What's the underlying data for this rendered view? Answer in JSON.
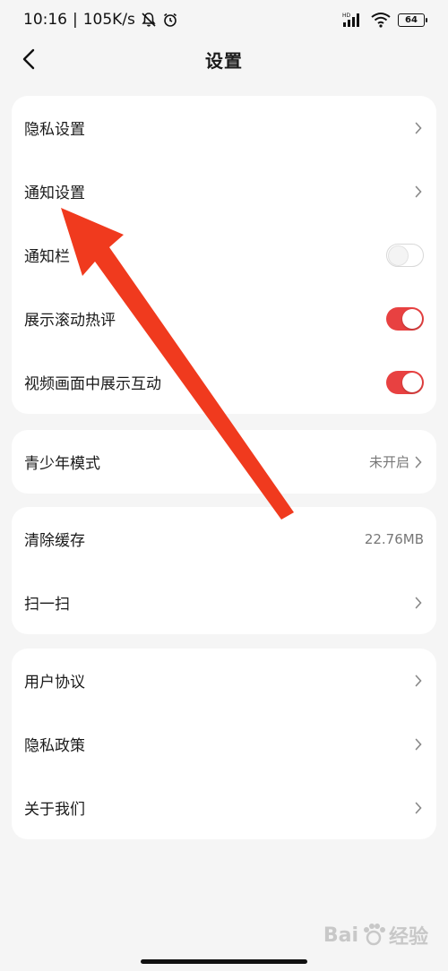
{
  "status_bar": {
    "time": "10:16",
    "speed": "105K/s",
    "battery": "64",
    "hd_label": "HD"
  },
  "nav": {
    "title": "设置"
  },
  "group1": {
    "items": [
      {
        "label": "隐私设置",
        "type": "link"
      },
      {
        "label": "通知设置",
        "type": "link"
      },
      {
        "label": "通知栏",
        "type": "toggle",
        "on": false
      },
      {
        "label": "展示滚动热评",
        "type": "toggle",
        "on": true
      },
      {
        "label": "视频画面中展示互动",
        "type": "toggle",
        "on": true
      }
    ]
  },
  "group2": {
    "items": [
      {
        "label": "青少年模式",
        "value": "未开启",
        "type": "link"
      }
    ]
  },
  "group3": {
    "items": [
      {
        "label": "清除缓存",
        "value": "22.76MB",
        "type": "value"
      },
      {
        "label": "扫一扫",
        "type": "link"
      }
    ]
  },
  "group4": {
    "items": [
      {
        "label": "用户协议",
        "type": "link"
      },
      {
        "label": "隐私政策",
        "type": "link"
      },
      {
        "label": "关于我们",
        "type": "link"
      }
    ]
  },
  "watermark": {
    "brand_text": "Bai",
    "brand_suffix": "经验"
  },
  "colors": {
    "accent": "#e84141",
    "arrow": "#f03a1e",
    "background": "#f5f5f5",
    "card": "#ffffff"
  },
  "icons": {
    "back": "chevron-left-icon",
    "row_arrow": "chevron-right-icon",
    "wifi": "wifi-icon",
    "signal": "signal-icon",
    "alarm": "alarm-icon",
    "mute": "bell-off-icon"
  }
}
